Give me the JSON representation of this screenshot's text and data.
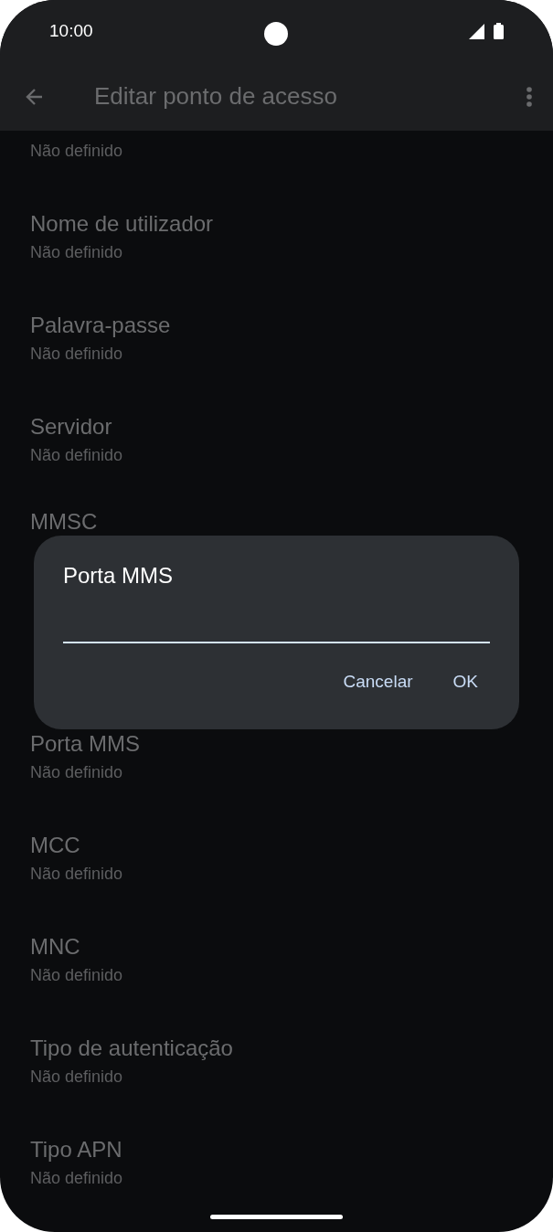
{
  "status_bar": {
    "time": "10:00"
  },
  "app_bar": {
    "title": "Editar ponto de acesso"
  },
  "settings_above_dialog": [
    {
      "subtitle": "Não definido"
    },
    {
      "title": "Nome de utilizador",
      "subtitle": "Não definido"
    },
    {
      "title": "Palavra-passe",
      "subtitle": "Não definido"
    },
    {
      "title": "Servidor",
      "subtitle": "Não definido"
    },
    {
      "title": "MMSC"
    }
  ],
  "settings_below_dialog": [
    {
      "title": "Porta MMS",
      "subtitle": "Não definido"
    },
    {
      "title": "MCC",
      "subtitle": "Não definido"
    },
    {
      "title": "MNC",
      "subtitle": "Não definido"
    },
    {
      "title": "Tipo de autenticação",
      "subtitle": "Não definido"
    },
    {
      "title": "Tipo APN",
      "subtitle": "Não definido"
    }
  ],
  "dialog": {
    "title": "Porta MMS",
    "buttons": [
      "Cancelar",
      "OK"
    ]
  }
}
